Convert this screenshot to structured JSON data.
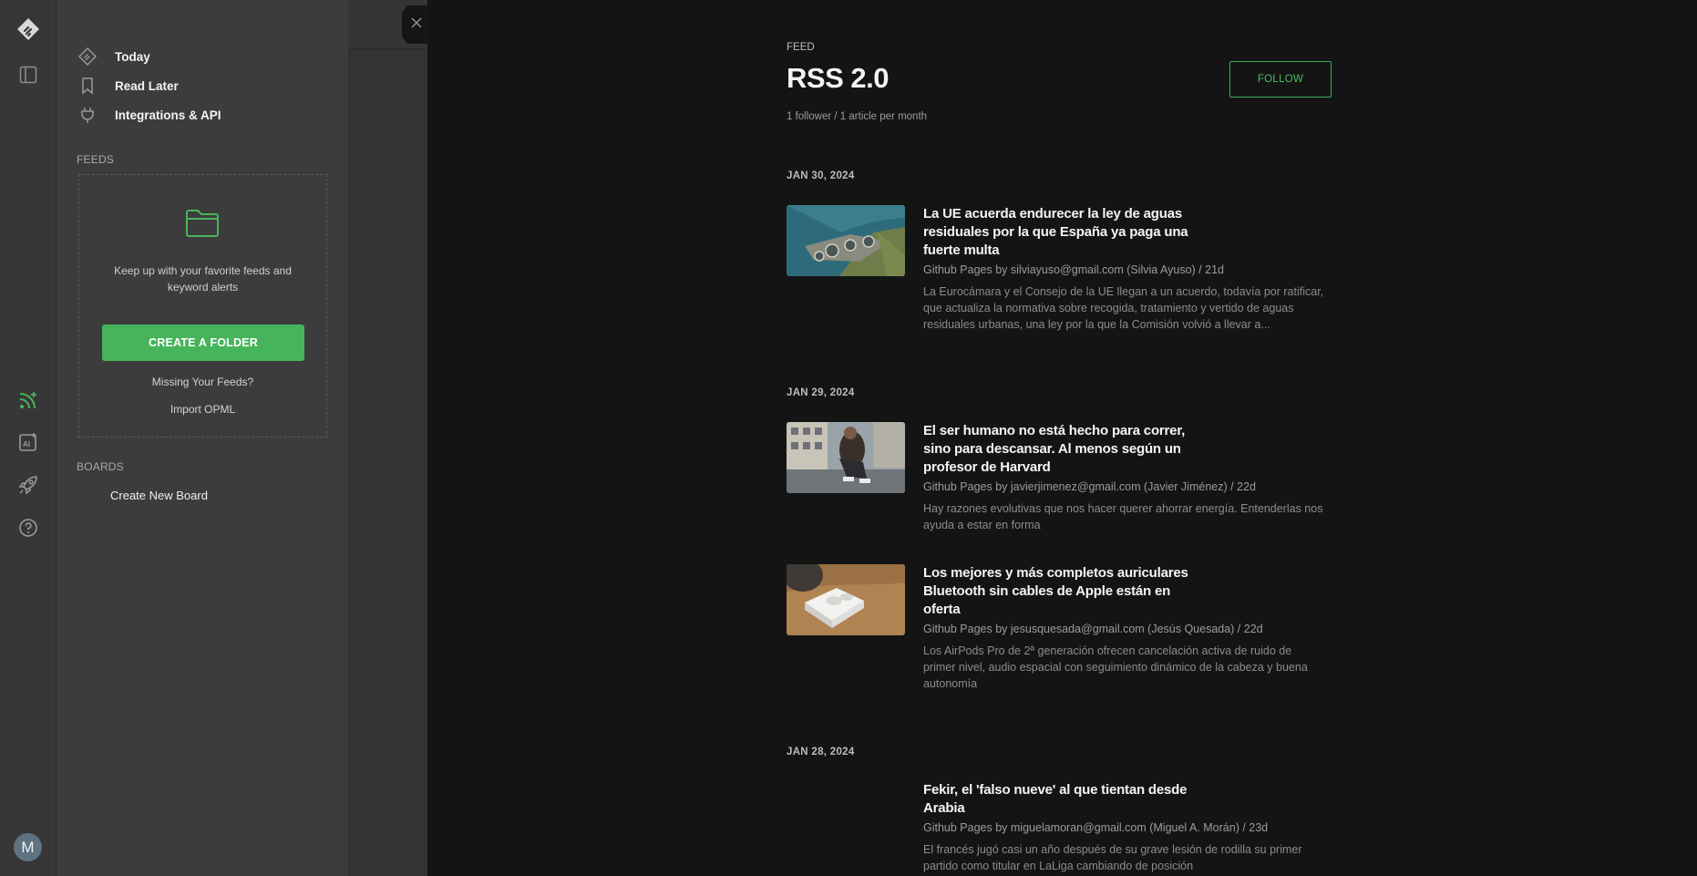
{
  "rail": {
    "icons": [
      "feedly-logo-icon",
      "sidebar-toggle-icon",
      "add-feed-icon",
      "ai-feed-icon",
      "rocket-icon",
      "help-icon"
    ],
    "avatar_initial": "M"
  },
  "nav": {
    "items": [
      {
        "label": "Today",
        "icon": "today-icon"
      },
      {
        "label": "Read Later",
        "icon": "bookmark-icon"
      },
      {
        "label": "Integrations & API",
        "icon": "plug-icon"
      }
    ],
    "feeds_label": "FEEDS",
    "feeds_empty": {
      "message": "Keep up with your favorite feeds and keyword alerts",
      "create_button": "CREATE A FOLDER",
      "missing_link": "Missing Your Feeds?",
      "import_link": "Import OPML"
    },
    "boards_label": "BOARDS",
    "create_board": "Create New Board"
  },
  "feed": {
    "kicker": "FEED",
    "title": "RSS 2.0",
    "stats": "1 follower / 1 article per month",
    "follow_label": "FOLLOW",
    "groups": [
      {
        "date": "JAN 30, 2024",
        "articles": [
          {
            "title": "La UE acuerda endurecer la ley de aguas residuales por la que España ya paga una fuerte multa",
            "meta": "Github Pages by silviayuso@gmail.com (Silvia Ayuso) / 21d",
            "desc": "La Eurocámara y el Consejo de la UE llegan a un acuerdo, todavía por ratificar, que actualiza la normativa sobre recogida, tratamiento y vertido de aguas residuales urbanas, una ley por la que la Comisión volvió a llevar a..."
          }
        ]
      },
      {
        "date": "JAN 29, 2024",
        "articles": [
          {
            "title": "El ser humano no está hecho para correr, sino para descansar. Al menos según un profesor de Harvard",
            "meta": "Github Pages by javierjimenez@gmail.com (Javier Jiménez) / 22d",
            "desc": "Hay razones evolutivas que nos hacer querer ahorrar energía. Entenderlas nos ayuda a estar en forma"
          },
          {
            "title": "Los mejores y más completos auriculares Bluetooth sin cables de Apple están en oferta",
            "meta": "Github Pages by jesusquesada@gmail.com (Jesús Quesada) / 22d",
            "desc": "Los AirPods Pro de 2ª generación ofrecen cancelación activa de ruido de primer nivel, audio espacial con seguimiento dinámico de la cabeza y buena autonomía"
          }
        ]
      },
      {
        "date": "JAN 28, 2024",
        "articles": [
          {
            "title": "Fekir, el 'falso nueve' al que tientan desde Arabia",
            "meta": "Github Pages by miguelamoran@gmail.com (Miguel A. Morán) / 23d",
            "desc": "El francés jugó casi un año después de su grave lesión de rodilla su primer partido como titular en LaLiga cambiando de posición"
          }
        ]
      }
    ]
  },
  "colors": {
    "accent": "#46b45a",
    "rail_bg": "#373737",
    "nav_bg": "#3c3c3c",
    "content_bg": "#141414"
  }
}
